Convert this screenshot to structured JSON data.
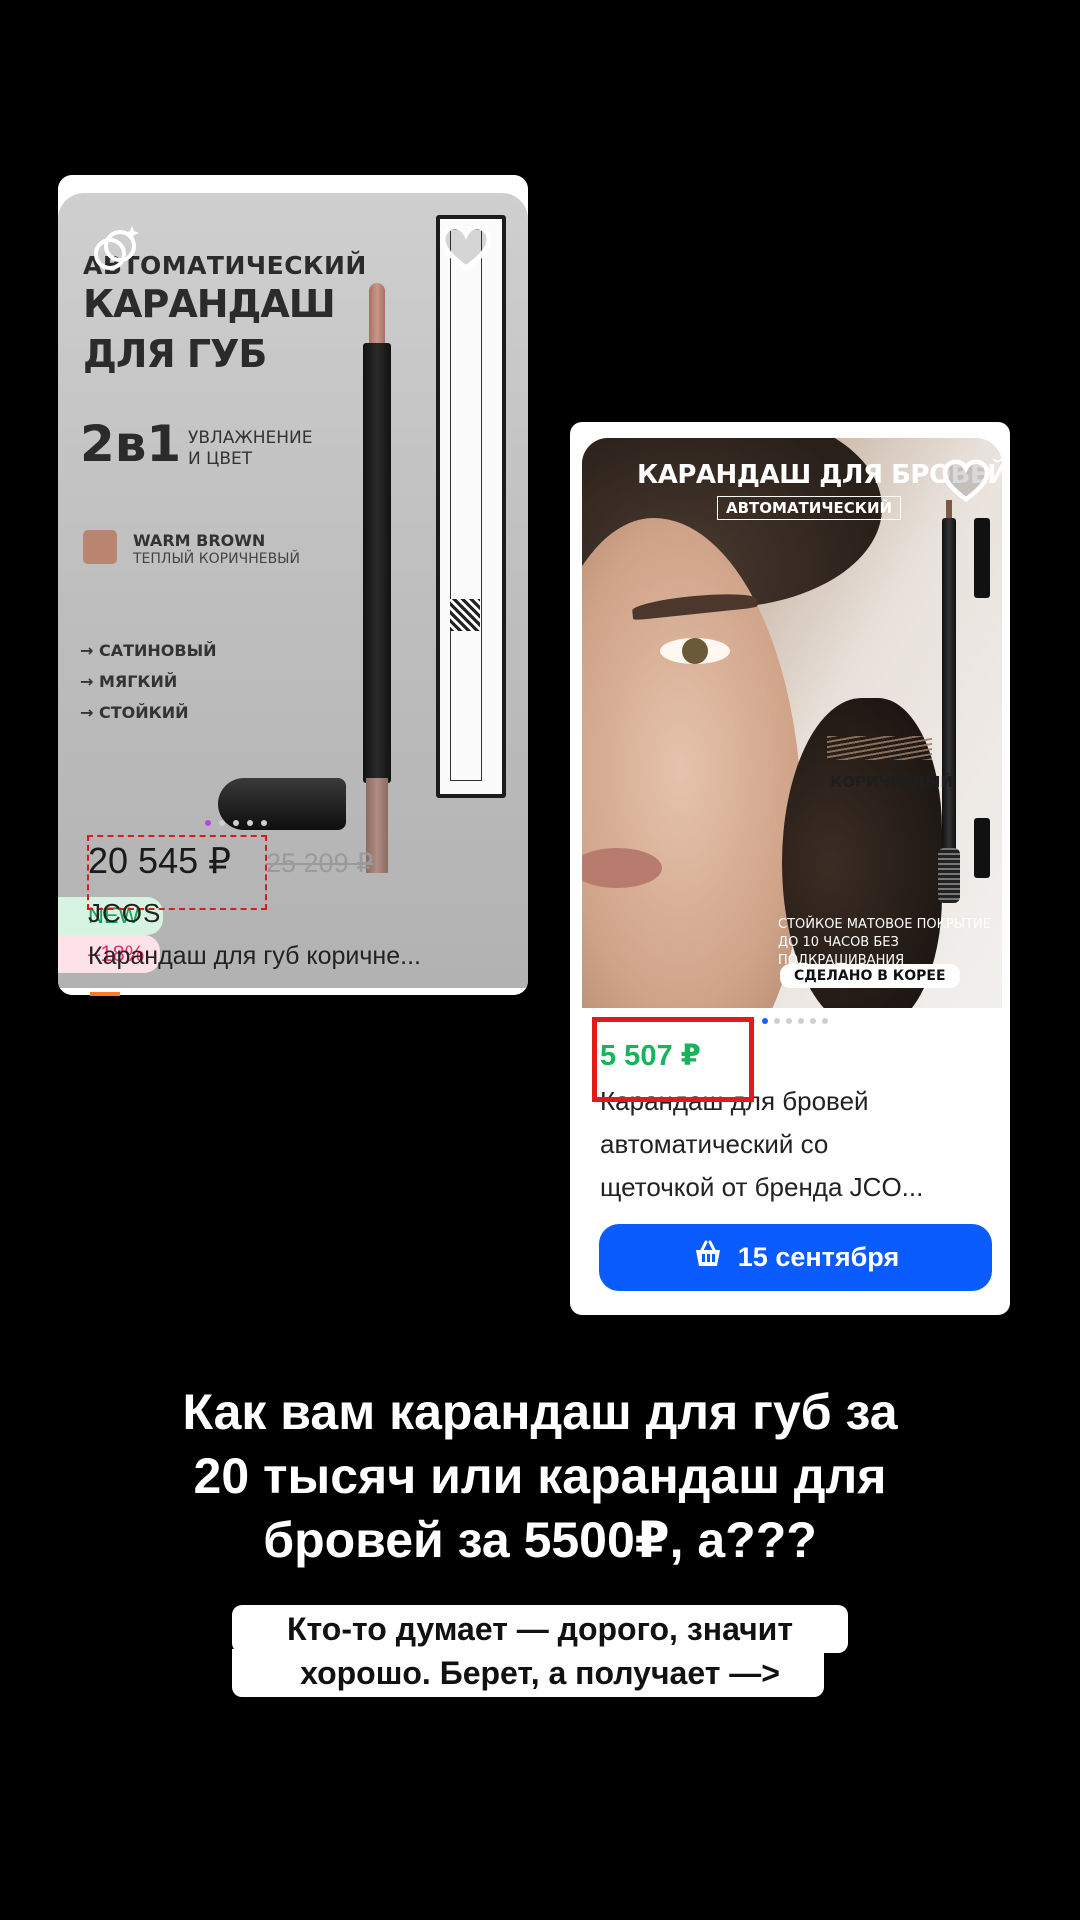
{
  "card1": {
    "promo": {
      "line1": "АВТОМАТИЧЕСКИЙ",
      "line2": "КАРАНДАШ",
      "line3": "ДЛЯ ГУБ",
      "two_in_one": "2в1",
      "benefit_1": "УВЛАЖНЕНИЕ",
      "benefit_2": "И ЦВЕТ",
      "shade": "WARM BROWN",
      "shade_ru": "ТЕПЛЫЙ КОРИЧНЕВЫЙ",
      "features": [
        "→ САТИНОВЫЙ",
        "→ МЯГКИЙ",
        "→ СТОЙКИЙ"
      ]
    },
    "badge_new": "NEW",
    "badge_discount": "–18%",
    "price": "20 545 ₽",
    "old_price": "25 209 ₽",
    "brand": "JCOS",
    "name": "Карандаш для губ коричне..."
  },
  "card2": {
    "promo": {
      "title": "КАРАНДАШ ДЛЯ БРОВЕЙ",
      "subtitle": "АВТОМАТИЧЕСКИЙ",
      "shade": "КОРИЧНЕВЫЙ",
      "claim_1": "СТОЙКОЕ МАТОВОЕ ПОКРЫТИЕ",
      "claim_2": "ДО 10 ЧАСОВ БЕЗ ПОДКРАШИВАНИЯ",
      "origin": "СДЕЛАНО В КОРЕЕ"
    },
    "price": "5 507 ₽",
    "name_lines": [
      "Карандаш для бровей",
      "автоматический со",
      "щеточкой от бренда JCO..."
    ],
    "cart_label": "15 сентября"
  },
  "headline": [
    "Как вам карандаш для губ за",
    "20 тысяч или карандаш для",
    "бровей за 5500₽, а???"
  ],
  "note": [
    "Кто-то думает — дорого, значит",
    "хорошо. Берет, а получает —>"
  ],
  "colors": {
    "accent_blue": "#0b5cff",
    "price_green": "#19b35b",
    "highlight_red": "#e01b1b",
    "discount_pink": "#e8326d"
  }
}
